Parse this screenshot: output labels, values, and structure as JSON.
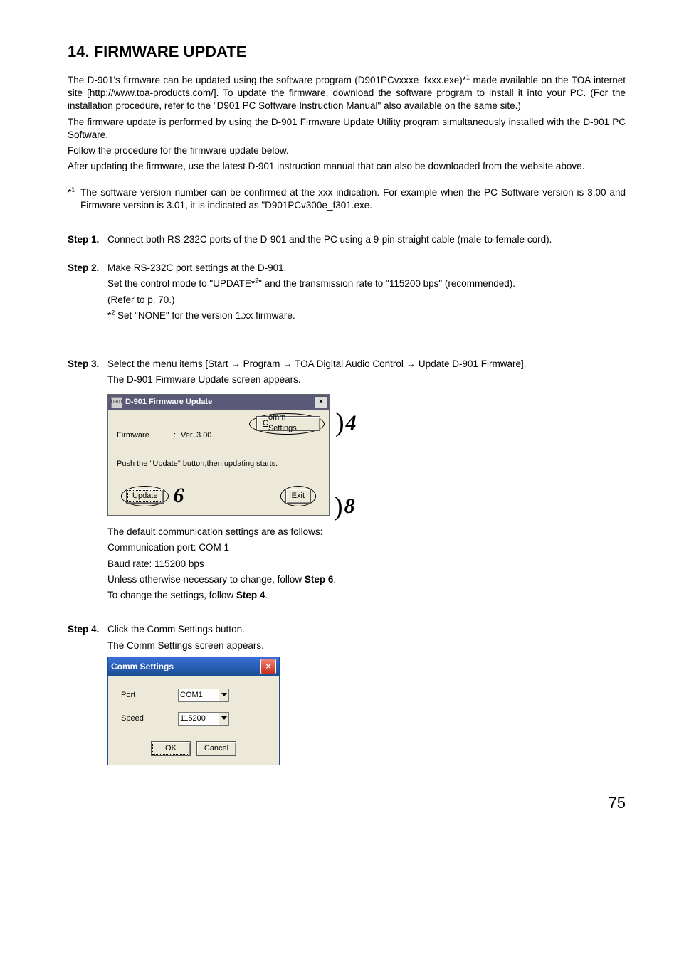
{
  "pageNumber": "75",
  "heading": "14. FIRMWARE UPDATE",
  "intro": {
    "p1a": "The D-901's firmware can be updated using the software program (D901PCvxxxe_fxxx.exe)*",
    "p1sup": "1",
    "p1b": " made available on the TOA internet site [http://www.toa-products.com/]. To update the firmware, download the software program to install it into your PC. (For the installation procedure, refer to the \"D901 PC Software Instruction Manual\" also available on the same site.)",
    "p2": "The firmware update is performed by using the D-901 Firmware Update Utility program simultaneously installed with the D-901 PC Software.",
    "p3": "Follow the procedure for the firmware update below.",
    "p4": "After updating the firmware, use the latest D-901 instruction manual that can also be downloaded from the website above."
  },
  "footnote1": {
    "marker": "*",
    "sup": "1",
    "text": "The software version number can be confirmed at the xxx indication. For example when the PC Software version is 3.00 and Firmware version is 3.01, it is indicated as \"D901PCv300e_f301.exe."
  },
  "step1": {
    "label": "Step 1.",
    "text": "Connect both RS-232C ports of the D-901 and the PC using a 9-pin straight cable (male-to-female cord)."
  },
  "step2": {
    "label": "Step 2.",
    "l1": "Make RS-232C port settings at the D-901.",
    "l2a": "Set the control mode to \"UPDATE*",
    "l2sup": "2",
    "l2b": "\" and the transmission rate to \"115200 bps\" (recommended).",
    "l3": "(Refer to p. 70.)",
    "fn_marker": "*",
    "fn_sup": "2",
    "fn_text": " Set \"NONE\" for the version 1.xx firmware."
  },
  "step3": {
    "label": "Step 3.",
    "l1": "Select the menu items [Start → Program → TOA Digital Audio Control → Update D-901 Firmware].",
    "l2": "The D-901 Firmware Update screen appears.",
    "after1": "The default communication settings are as follows:",
    "after2": "Communication port: COM 1",
    "after3": "Baud rate: 115200 bps",
    "after4a": "Unless otherwise necessary to change, follow ",
    "after4b": "Step 6",
    "after4c": ".",
    "after5a": "To change the settings, follow ",
    "after5b": "Step 4",
    "after5c": "."
  },
  "step4": {
    "label": "Step 4.",
    "l1": "Click the Comm Settings button.",
    "l2": "The Comm Settings screen appears."
  },
  "dialog1": {
    "title": "D-901 Firmware Update",
    "icon_text": "D901",
    "close": "×",
    "fw_label": "Firmware",
    "fw_colon": ":",
    "fw_value": "Ver. 3.00",
    "comm_u": "C",
    "comm_rest": "omm Settings",
    "body_text": "Push the \"Update\" button,then updating starts.",
    "update_u": "U",
    "update_rest": "pdate",
    "exit_pre": "E",
    "exit_u": "x",
    "exit_rest": "it",
    "callout4": "4",
    "callout6": "6",
    "callout8": "8"
  },
  "dialog2": {
    "title": "Comm Settings",
    "close": "×",
    "port_label": "Port",
    "port_value": "COM1",
    "speed_label": "Speed",
    "speed_value": "115200",
    "ok": "OK",
    "cancel": "Cancel"
  }
}
